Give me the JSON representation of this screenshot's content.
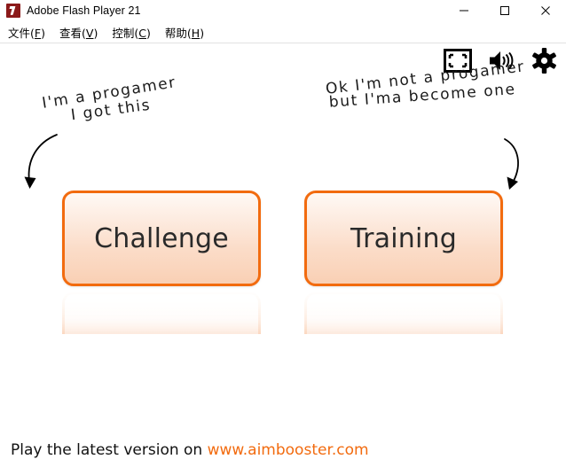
{
  "window": {
    "title": "Adobe Flash Player 21",
    "icon": "flash-player-icon",
    "controls": {
      "minimize": "—",
      "maximize": "□",
      "close": "✕"
    }
  },
  "menubar": {
    "items": [
      {
        "label": "文件",
        "accel": "F"
      },
      {
        "label": "查看",
        "accel": "V"
      },
      {
        "label": "控制",
        "accel": "C"
      },
      {
        "label": "帮助",
        "accel": "H"
      }
    ]
  },
  "toolbar": {
    "icons": [
      {
        "name": "fullscreen-icon"
      },
      {
        "name": "volume-icon"
      },
      {
        "name": "settings-gear-icon"
      }
    ]
  },
  "stage": {
    "annotations": [
      {
        "id": "challenge-annotation",
        "line1": "I'm a progamer",
        "line2": "I got this"
      },
      {
        "id": "training-annotation",
        "line1": "Ok I'm not a progamer",
        "line2": "but I'ma become one"
      }
    ],
    "buttons": [
      {
        "id": "challenge",
        "label": "Challenge"
      },
      {
        "id": "training",
        "label": "Training"
      }
    ],
    "footer": {
      "text": "Play the latest version on ",
      "link": "www.aimbooster.com"
    }
  },
  "colors": {
    "accent_orange": "#F26B0F",
    "button_fill_top": "#FFF9F5",
    "button_fill_bottom": "#F9CFB4",
    "background": "#FFFFFF",
    "title_icon": "#8B1A1A"
  }
}
